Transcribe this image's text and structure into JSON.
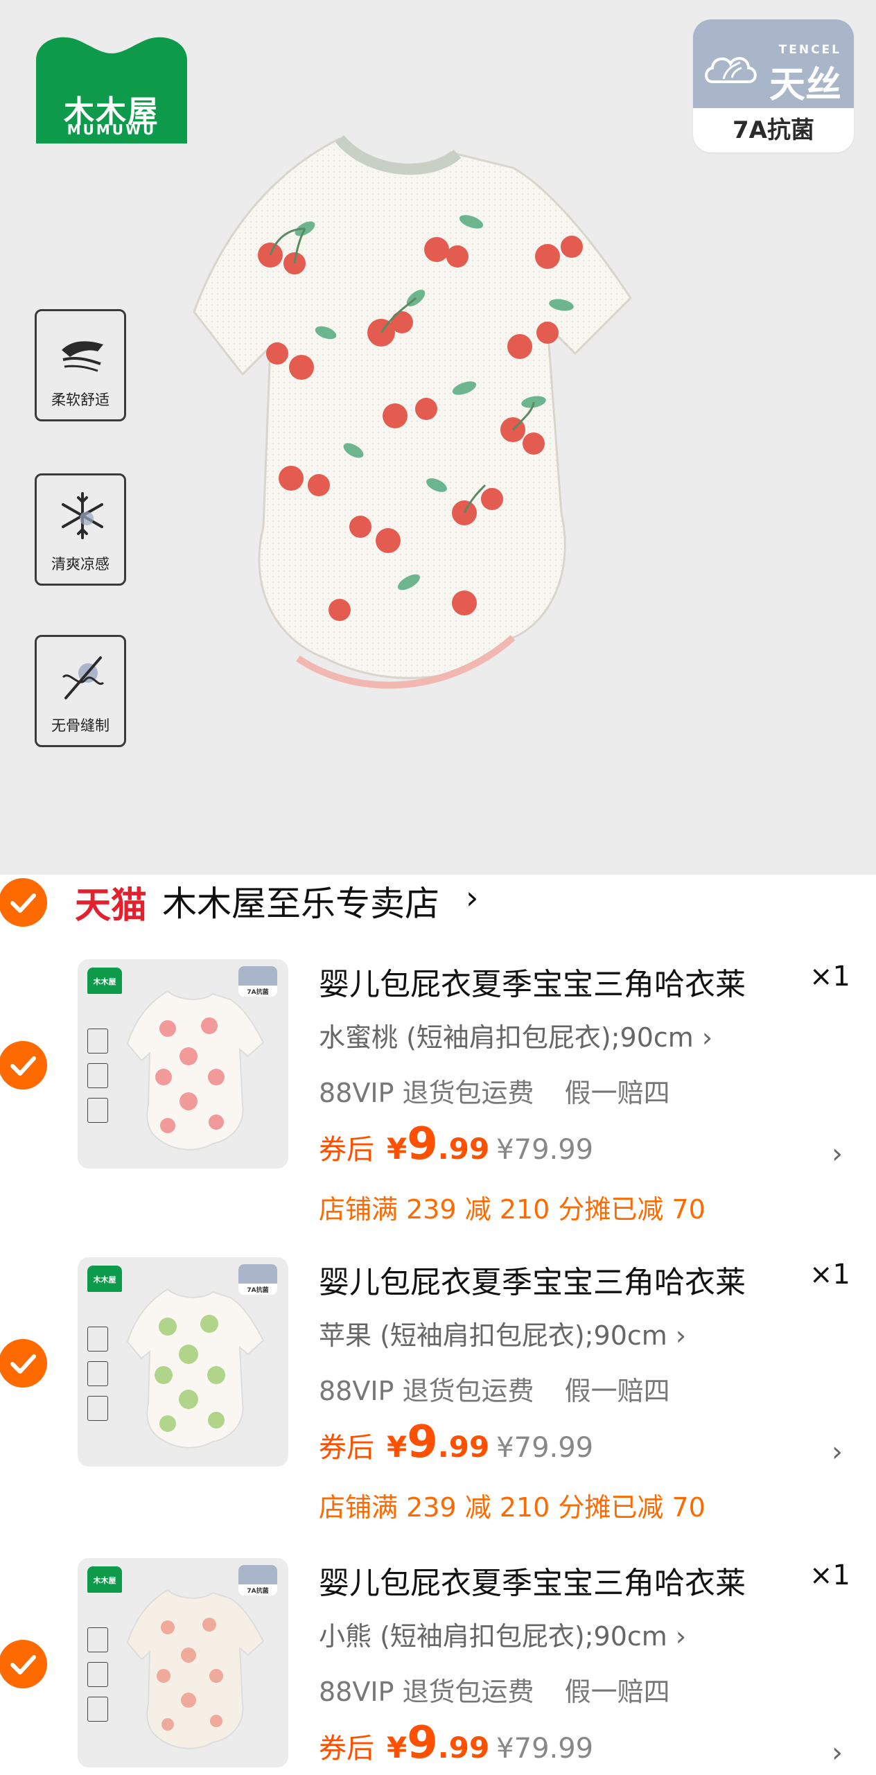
{
  "hero": {
    "brand_name": "木木屋",
    "brand_latin": "MUMUWU",
    "tencel_small": "TENCEL",
    "tencel_big": "天丝",
    "tencel_sub": "7A抗菌",
    "features": [
      "柔软舒适",
      "清爽凉感",
      "无骨缝制"
    ],
    "colors": {
      "brand_green": "#0d9a4b",
      "tencel_blue": "#a9b6c9",
      "cherry_red": "#e45b50"
    }
  },
  "store": {
    "platform": "天猫",
    "name": "木木屋至乐专卖店",
    "chevron": "›"
  },
  "items": [
    {
      "title": "婴儿包屁衣夏季宝宝三角哈衣莱",
      "qty": "×1",
      "variant": "水蜜桃 (短袖肩扣包屁衣);90cm ›",
      "service_1": "88VIP 退货包运费",
      "service_2": "假一赔四",
      "price_prefix": "券后",
      "currency": "¥",
      "price_int": "9",
      "price_dec": ".99",
      "original_price": "¥79.99",
      "promo": "店铺满 239 减 210 分摊已减 70",
      "print_color": "#f08a8a"
    },
    {
      "title": "婴儿包屁衣夏季宝宝三角哈衣莱",
      "qty": "×1",
      "variant": "苹果 (短袖肩扣包屁衣);90cm ›",
      "service_1": "88VIP 退货包运费",
      "service_2": "假一赔四",
      "price_prefix": "券后",
      "currency": "¥",
      "price_int": "9",
      "price_dec": ".99",
      "original_price": "¥79.99",
      "promo": "店铺满 239 减 210 分摊已减 70",
      "print_color": "#a9d27f"
    },
    {
      "title": "婴儿包屁衣夏季宝宝三角哈衣莱",
      "qty": "×1",
      "variant": "小熊 (短袖肩扣包屁衣);90cm ›",
      "service_1": "88VIP 退货包运费",
      "service_2": "假一赔四",
      "price_prefix": "券后",
      "currency": "¥",
      "price_int": "9",
      "price_dec": ".99",
      "original_price": "¥79.99",
      "promo": "",
      "print_color": "#ef9e8e"
    }
  ],
  "accent_color": "#ff6a00"
}
